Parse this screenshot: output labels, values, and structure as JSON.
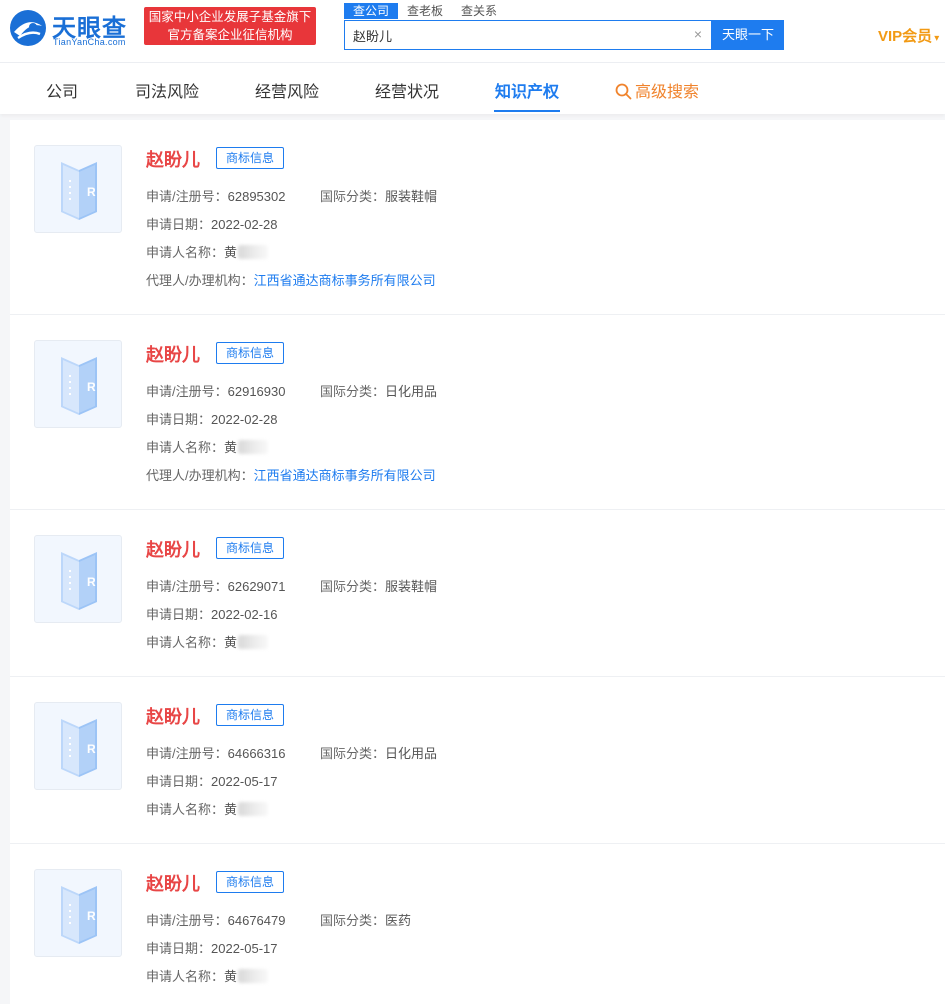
{
  "header": {
    "logo_text": "天眼查",
    "logo_sub": "TianYanCha.com",
    "gov_line1": "国家中小企业发展子基金旗下",
    "gov_line2": "官方备案企业征信机构",
    "search_tabs": [
      "查公司",
      "查老板",
      "查关系"
    ],
    "search_value": "赵盼儿",
    "search_button": "天眼一下",
    "vip": "VIP会员"
  },
  "nav": {
    "items": [
      "公司",
      "司法风险",
      "经营风险",
      "经营状况",
      "知识产权"
    ],
    "active": "知识产权",
    "advanced": "高级搜索"
  },
  "labels": {
    "reg_no": "申请/注册号：",
    "intl_class": "国际分类：",
    "apply_date": "申请日期：",
    "applicant": "申请人名称：",
    "agent": "代理人/办理机构："
  },
  "results": [
    {
      "title": "赵盼儿",
      "tag": "商标信息",
      "reg_no": "62895302",
      "intl_class": "服装鞋帽",
      "apply_date": "2022-02-28",
      "applicant": "黄",
      "agent": "江西省通达商标事务所有限公司"
    },
    {
      "title": "赵盼儿",
      "tag": "商标信息",
      "reg_no": "62916930",
      "intl_class": "日化用品",
      "apply_date": "2022-02-28",
      "applicant": "黄",
      "agent": "江西省通达商标事务所有限公司"
    },
    {
      "title": "赵盼儿",
      "tag": "商标信息",
      "reg_no": "62629071",
      "intl_class": "服装鞋帽",
      "apply_date": "2022-02-16",
      "applicant": "黄"
    },
    {
      "title": "赵盼儿",
      "tag": "商标信息",
      "reg_no": "64666316",
      "intl_class": "日化用品",
      "apply_date": "2022-05-17",
      "applicant": "黄"
    },
    {
      "title": "赵盼儿",
      "tag": "商标信息",
      "reg_no": "64676479",
      "intl_class": "医药",
      "apply_date": "2022-05-17",
      "applicant": "黄"
    }
  ],
  "colors": {
    "brand": "#1e7cef",
    "title_red": "#e84646",
    "gov_red": "#e8363a",
    "vip_gold": "#f29a14",
    "advanced_orange": "#f0832c"
  }
}
